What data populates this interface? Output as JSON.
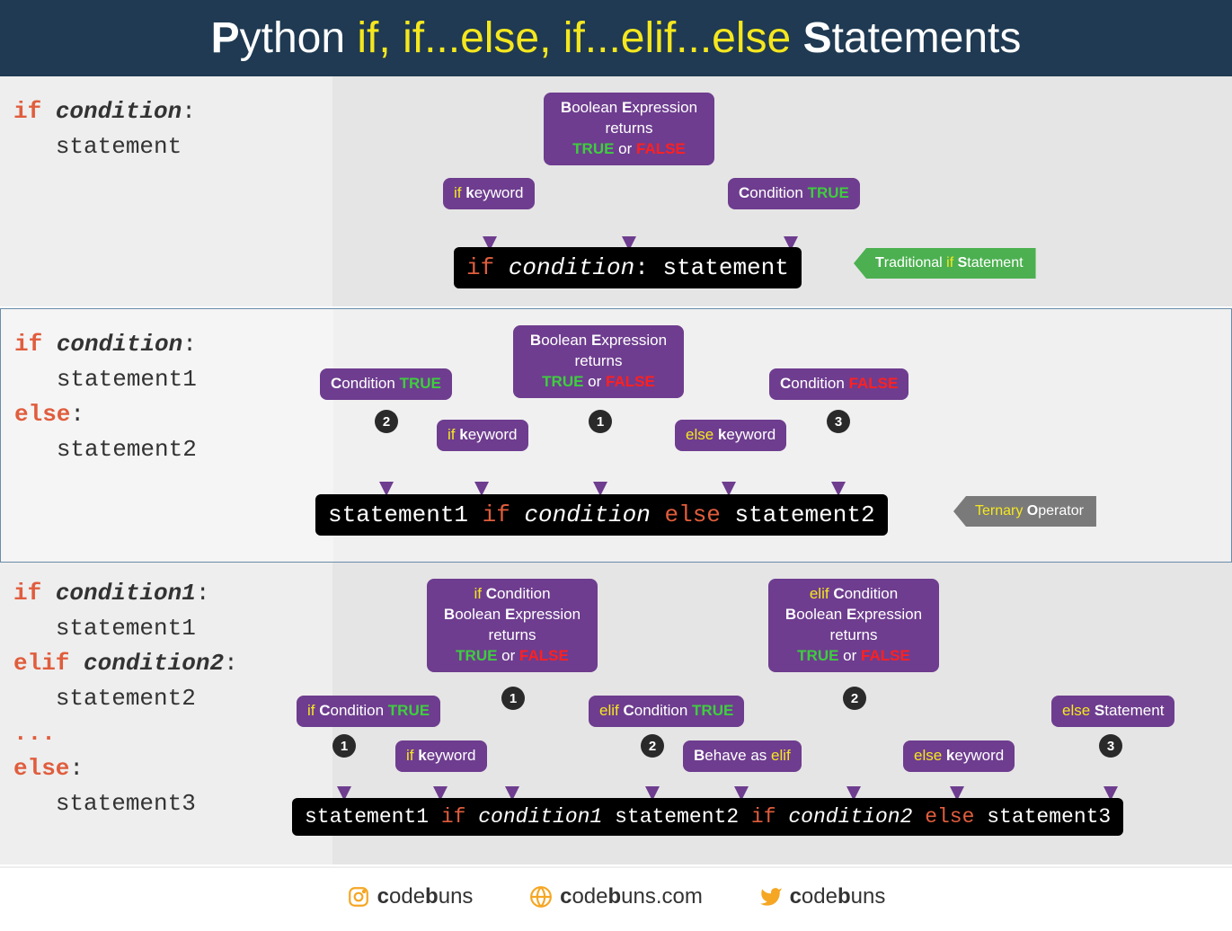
{
  "header": {
    "P": "P",
    "ython": "ython ",
    "ifpart": "if, if...else, if...elif...else",
    "S": " S",
    "tatements": "tatements"
  },
  "s1": {
    "code": {
      "if": "if",
      "cond": "condition",
      "stmt": "statement"
    },
    "boxBool": {
      "l1a": "B",
      "l1b": "oolean ",
      "l1c": "E",
      "l1d": "xpression",
      "l2": "returns",
      "t": "TRUE",
      "or": " or ",
      "f": "FALSE"
    },
    "boxIfKw": {
      "a": "if ",
      "b": "k",
      "c": "eyword"
    },
    "boxCondT": {
      "a": "C",
      "b": "ondition ",
      "t": "TRUE"
    },
    "bar": {
      "if": "if ",
      "cond": "condition",
      ":": ": ",
      "stmt": "statement"
    },
    "tag": {
      "a": "T",
      "b": "raditional ",
      "c": "if ",
      "d": "S",
      "e": "tatement"
    }
  },
  "s2": {
    "code": {
      "if": "if",
      "cond": "condition",
      "s1": "statement1",
      "else": "else",
      "s2": "statement2"
    },
    "boxCondT": {
      "a": "C",
      "b": "ondition ",
      "t": "TRUE"
    },
    "boxBool": {
      "l1a": "B",
      "l1b": "oolean ",
      "l1c": "E",
      "l1d": "xpression",
      "l2": "returns",
      "t": "TRUE",
      "or": " or ",
      "f": "FALSE"
    },
    "boxCondF": {
      "a": "C",
      "b": "ondition ",
      "r": "FALSE"
    },
    "boxIfKw": {
      "a": "if ",
      "b": "k",
      "c": "eyword"
    },
    "boxElseKw": {
      "a": "else ",
      "b": "k",
      "c": "eyword"
    },
    "n1": "1",
    "n2": "2",
    "n3": "3",
    "bar": {
      "s1": "statement1 ",
      "if": "if ",
      "cond": "condition",
      "sp": " ",
      "else": "else",
      "s2": " statement2"
    },
    "tag": {
      "a": "Ternary ",
      "b": "O",
      "c": "perator"
    }
  },
  "s3": {
    "code": {
      "if": "if",
      "c1": "condition1",
      "s1": "statement1",
      "elif": "elif",
      "c2": "condition2",
      "s2": "statement2",
      "dots": "...",
      "else": "else",
      "s3": "statement3"
    },
    "boxIfBool": {
      "l0a": "if ",
      "l0b": "C",
      "l0c": "ondition",
      "l1a": "B",
      "l1b": "oolean ",
      "l1c": "E",
      "l1d": "xpression",
      "l2": "returns",
      "t": "TRUE",
      "or": " or ",
      "f": "FALSE"
    },
    "boxElifBool": {
      "l0a": "elif ",
      "l0b": "C",
      "l0c": "ondition",
      "l1a": "B",
      "l1b": "oolean ",
      "l1c": "E",
      "l1d": "xpression",
      "l2": "returns",
      "t": "TRUE",
      "or": " or ",
      "f": "FALSE"
    },
    "boxIfCondT": {
      "a": "if ",
      "b": "C",
      "c": "ondition ",
      "t": "TRUE"
    },
    "boxElifCondT": {
      "a": "elif ",
      "b": "C",
      "c": "ondition ",
      "t": "TRUE"
    },
    "boxElseStmt": {
      "a": "else ",
      "b": "S",
      "c": "tatement"
    },
    "boxIfKw": {
      "a": "if ",
      "b": "k",
      "c": "eyword"
    },
    "boxBehave": {
      "a": "B",
      "b": "ehave as ",
      "c": "elif"
    },
    "boxElseKw": {
      "a": "else ",
      "b": "k",
      "c": "eyword"
    },
    "n1": "1",
    "n2": "2",
    "n3": "3",
    "bar": {
      "s1": "statement1 ",
      "if": "if ",
      "c1": "condition1",
      "sp1": " ",
      "s2": "statement2 ",
      "if2": "if ",
      "c2": "condition2",
      "sp2": " ",
      "else": "else",
      "s3": " statement3"
    }
  },
  "footer": {
    "c": "c",
    "ode": "ode",
    "b": "b",
    "uns": "uns",
    "com": ".com"
  }
}
